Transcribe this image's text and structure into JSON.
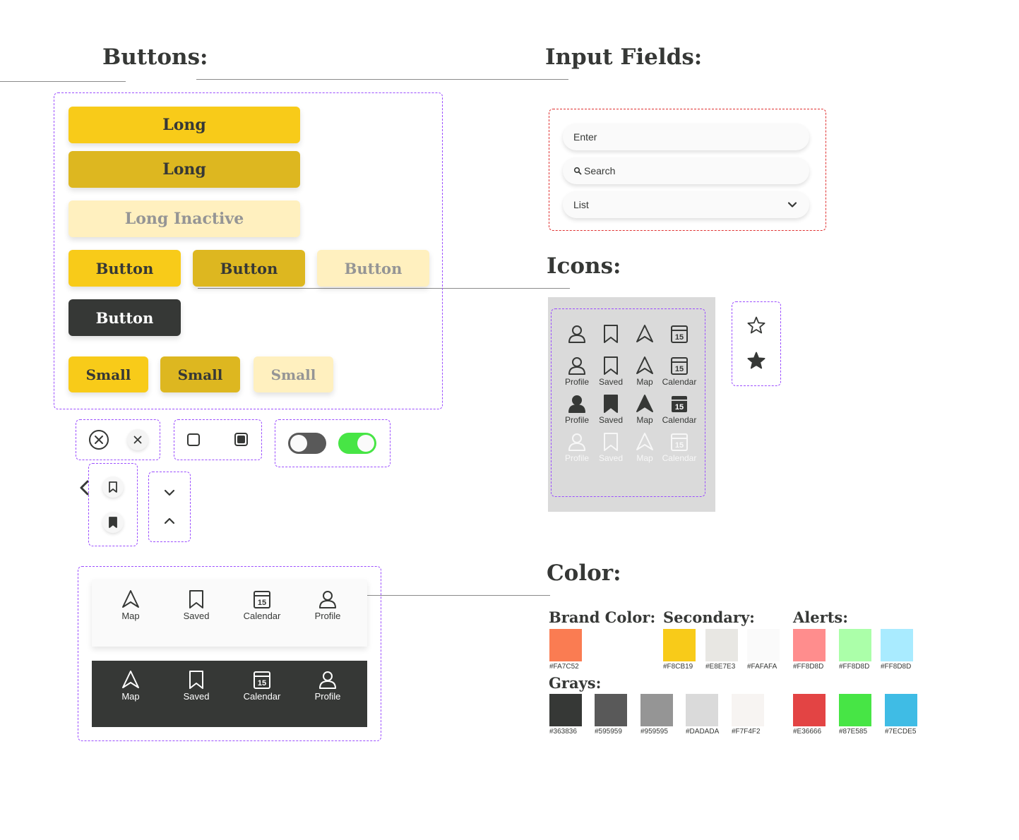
{
  "headings": {
    "buttons": "Buttons:",
    "inputs": "Input Fields:",
    "icons": "Icons:",
    "color": "Color:"
  },
  "buttons": {
    "long_primary": "Long",
    "long_pressed": "Long",
    "long_inactive": "Long Inactive",
    "button_primary": "Button",
    "button_pressed": "Button",
    "button_inactive": "Button",
    "button_dark": "Button",
    "small_primary": "Small",
    "small_pressed": "Small",
    "small_inactive": "Small"
  },
  "inputs": {
    "enter": "Enter",
    "search": "Search",
    "list": "List"
  },
  "icon_grid": {
    "rows": [
      {
        "style": "outline-large",
        "labels": [
          "",
          "",
          "",
          ""
        ]
      },
      {
        "style": "outline",
        "labels": [
          "Profile",
          "Saved",
          "Map",
          "Calendar"
        ]
      },
      {
        "style": "filled",
        "labels": [
          "Profile",
          "Saved",
          "Map",
          "Calendar"
        ]
      },
      {
        "style": "inactive",
        "labels": [
          "Profile",
          "Saved",
          "Map",
          "Calendar"
        ]
      }
    ],
    "calendar_day": "15",
    "icon_names": [
      "profile-icon",
      "saved-icon",
      "map-icon",
      "calendar-icon"
    ]
  },
  "stars": [
    "star-outline-icon",
    "star-filled-icon"
  ],
  "controls": {
    "close_icons": [
      "close-circle-icon",
      "close-small-icon"
    ],
    "checkboxes": [
      "checkbox-unchecked",
      "checkbox-checked"
    ],
    "toggles": [
      {
        "state": "off",
        "color": "#595959"
      },
      {
        "state": "on",
        "color": "#47E545"
      }
    ],
    "chevrons": [
      "chevron-left-icon",
      "chevron-down-icon",
      "chevron-up-icon"
    ],
    "bookmarks": [
      "bookmark-outline-icon",
      "bookmark-filled-icon"
    ]
  },
  "nav_bars": {
    "light": {
      "items": [
        {
          "label": "Map"
        },
        {
          "label": "Saved"
        },
        {
          "label": "Calendar"
        },
        {
          "label": "Profile"
        }
      ]
    },
    "dark": {
      "items": [
        {
          "label": "Map"
        },
        {
          "label": "Saved"
        },
        {
          "label": "Calendar"
        },
        {
          "label": "Profile"
        }
      ]
    }
  },
  "colors": {
    "brand_title": "Brand Color:",
    "secondary_title": "Secondary:",
    "alerts_title": "Alerts:",
    "grays_title": "Grays:",
    "brand": [
      {
        "hex": "#FA7C52",
        "label": "#FA7C52"
      }
    ],
    "secondary": [
      {
        "hex": "#F8CB19",
        "label": "#F8CB19"
      },
      {
        "hex": "#E8E7E3",
        "label": "#E8E7E3"
      },
      {
        "hex": "#FAFAFA",
        "label": "#FAFAFA"
      }
    ],
    "alerts_light": [
      {
        "hex": "#FF8D8D",
        "label": "#FF8D8D"
      },
      {
        "hex": "#ABFFA9",
        "label": "#FF8D8D"
      },
      {
        "hex": "#A9EBFF",
        "label": "#FF8D8D"
      }
    ],
    "grays": [
      {
        "hex": "#363836",
        "label": "#363836"
      },
      {
        "hex": "#595959",
        "label": "#595959"
      },
      {
        "hex": "#959595",
        "label": "#959595"
      },
      {
        "hex": "#DADADA",
        "label": "#DADADA"
      },
      {
        "hex": "#F7F4F2",
        "label": "#F7F4F2"
      }
    ],
    "alerts_dark": [
      {
        "hex": "#E34444",
        "label": "#E36666"
      },
      {
        "hex": "#47E545",
        "label": "#87E585"
      },
      {
        "hex": "#3FBCE5",
        "label": "#7ECDE5"
      }
    ]
  }
}
